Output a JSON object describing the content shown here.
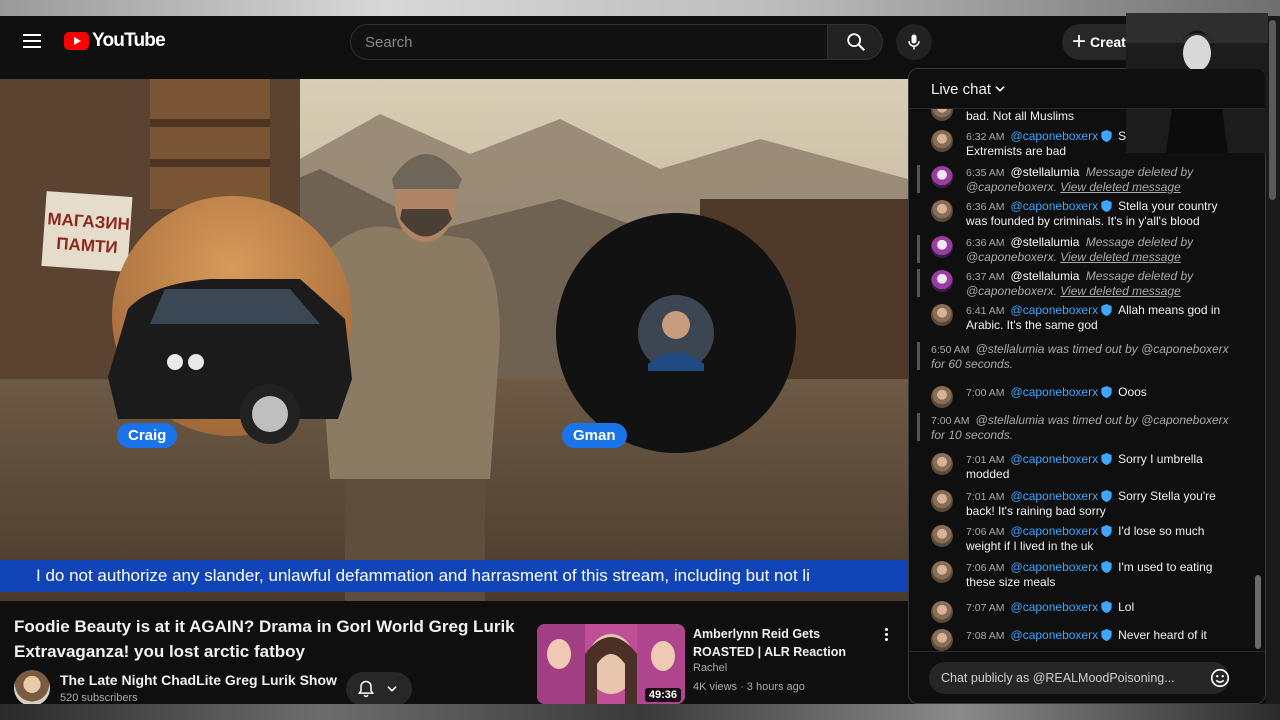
{
  "header": {
    "logo_text": "YouTube",
    "search_placeholder": "Search",
    "create_label": "Creat"
  },
  "video": {
    "cam_labels": [
      "Craig",
      "Gman"
    ],
    "sign_text": "МАГАЗИН ПАМТИ",
    "ticker": "I do not authorize any slander, unlawful defammation and harrasment of this stream, including but not li",
    "title": "Foodie Beauty is at it AGAIN? Drama in Gorl World Greg Lurik Extravaganza! you lost arctic fatboy",
    "channel": "The Late Night ChadLite Greg Lurik Show",
    "subscribers": "520 subscribers"
  },
  "recommended": {
    "title": "Amberlynn Reid Gets ROASTED | ALR Reaction",
    "channel": "Rachel",
    "meta": "4K views · 3 hours ago",
    "duration": "49:36"
  },
  "chat": {
    "title": "Live chat",
    "input_placeholder": "Chat publicly as @REALMoodPoisoning...",
    "messages": [
      {
        "type": "partial",
        "text": "bad. Not all Muslims"
      },
      {
        "type": "msg",
        "time": "6:32 AM",
        "author": "@caponeboxerx",
        "text": "Say religion. Extremists are bad"
      },
      {
        "type": "deleted",
        "time": "6:35 AM",
        "author": "@stellalumia",
        "text": "Message deleted by @caponeboxerx.",
        "link": "View deleted message"
      },
      {
        "type": "msg",
        "time": "6:36 AM",
        "author": "@caponeboxerx",
        "text": "Stella your country was founded by criminals. It's in y'all's blood"
      },
      {
        "type": "deleted",
        "time": "6:36 AM",
        "author": "@stellalumia",
        "text": "Message deleted by @caponeboxerx.",
        "link": "View deleted message"
      },
      {
        "type": "deleted",
        "time": "6:37 AM",
        "author": "@stellalumia",
        "text": "Message deleted by @caponeboxerx.",
        "link": "View deleted message"
      },
      {
        "type": "msg",
        "time": "6:41 AM",
        "author": "@caponeboxerx",
        "text": "Allah means god in Arabic. It's the same god"
      },
      {
        "type": "sys",
        "time": "6:50 AM",
        "text": "@stellalumia was timed out by @caponeboxerx for 60 seconds."
      },
      {
        "type": "msg",
        "time": "7:00 AM",
        "author": "@caponeboxerx",
        "text": "Ooos"
      },
      {
        "type": "sys",
        "time": "7:00 AM",
        "text": "@stellalumia was timed out by @caponeboxerx for 10 seconds."
      },
      {
        "type": "msg",
        "time": "7:01 AM",
        "author": "@caponeboxerx",
        "text": "Sorry I umbrella modded"
      },
      {
        "type": "msg",
        "time": "7:01 AM",
        "author": "@caponeboxerx",
        "text": "Sorry Stella you're back! It's raining bad sorry"
      },
      {
        "type": "msg",
        "time": "7:06 AM",
        "author": "@caponeboxerx",
        "text": "I'd lose so much weight if I lived in the uk"
      },
      {
        "type": "msg",
        "time": "7:06 AM",
        "author": "@caponeboxerx",
        "text": "I'm used to eating these size meals"
      },
      {
        "type": "msg",
        "time": "7:07 AM",
        "author": "@caponeboxerx",
        "text": "Lol"
      },
      {
        "type": "msg",
        "time": "7:08 AM",
        "author": "@caponeboxerx",
        "text": "Never heard of it"
      }
    ]
  },
  "colors": {
    "background": "#0f0f0f",
    "brand_red": "#ff0000",
    "moderator_blue": "#3ea6ff",
    "ticker_blue": "#1144b6",
    "cam_label_blue": "#1a73e8"
  },
  "icons": [
    "menu-icon",
    "youtube-logo-icon",
    "search-icon",
    "microphone-icon",
    "plus-icon",
    "chevron-down-icon",
    "bell-icon",
    "more-vert-icon",
    "moderator-shield-icon",
    "emoji-icon"
  ]
}
